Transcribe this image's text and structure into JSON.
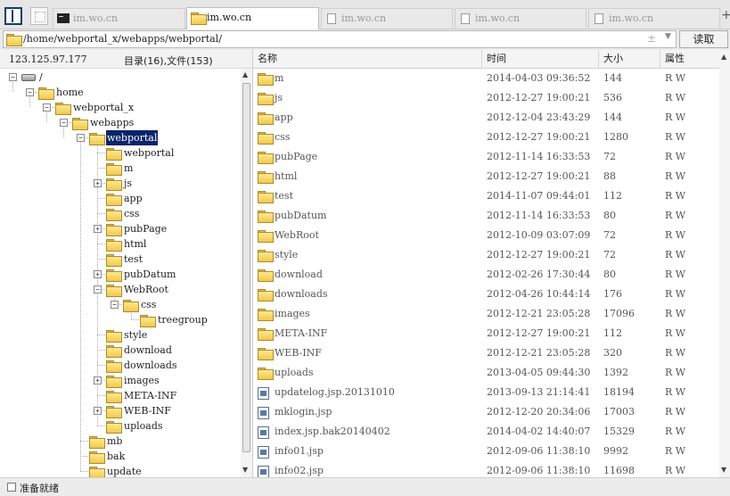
{
  "tabs": [
    {
      "label": "im.wo.cn",
      "icon": "terminal-icon",
      "active": false
    },
    {
      "label": "im.wo.cn",
      "icon": "folder-icon",
      "active": true
    },
    {
      "label": "im.wo.cn",
      "icon": "document-icon",
      "active": false
    },
    {
      "label": "im.wo.cn",
      "icon": "document-icon",
      "active": false
    },
    {
      "label": "im.wo.cn",
      "icon": "document-icon",
      "active": false
    }
  ],
  "tab_add": "+",
  "address": {
    "path": "/home/webportal_x/webapps/webportal/",
    "history_glyph": "±",
    "dropdown_glyph": "▼"
  },
  "read_button": "读取",
  "info": {
    "ip": "123.125.97.177",
    "counts": "目录(16),文件(153)"
  },
  "tree": [
    {
      "label": "/",
      "kind": "drive",
      "depth": 0,
      "toggle": "−"
    },
    {
      "label": "home",
      "kind": "folder",
      "depth": 1,
      "toggle": "−"
    },
    {
      "label": "webportal_x",
      "kind": "folder",
      "depth": 2,
      "toggle": "−"
    },
    {
      "label": "webapps",
      "kind": "folder",
      "depth": 3,
      "toggle": "−"
    },
    {
      "label": "webportal",
      "kind": "folder",
      "depth": 4,
      "toggle": "−",
      "selected": true
    },
    {
      "label": "webportal",
      "kind": "folder",
      "depth": 5,
      "toggle": ""
    },
    {
      "label": "m",
      "kind": "folder",
      "depth": 5,
      "toggle": ""
    },
    {
      "label": "js",
      "kind": "folder",
      "depth": 5,
      "toggle": "+"
    },
    {
      "label": "app",
      "kind": "folder",
      "depth": 5,
      "toggle": ""
    },
    {
      "label": "css",
      "kind": "folder",
      "depth": 5,
      "toggle": ""
    },
    {
      "label": "pubPage",
      "kind": "folder",
      "depth": 5,
      "toggle": "+"
    },
    {
      "label": "html",
      "kind": "folder",
      "depth": 5,
      "toggle": ""
    },
    {
      "label": "test",
      "kind": "folder",
      "depth": 5,
      "toggle": ""
    },
    {
      "label": "pubDatum",
      "kind": "folder",
      "depth": 5,
      "toggle": "+"
    },
    {
      "label": "WebRoot",
      "kind": "folder",
      "depth": 5,
      "toggle": "−"
    },
    {
      "label": "css",
      "kind": "folder",
      "depth": 6,
      "toggle": "−"
    },
    {
      "label": "treegroup",
      "kind": "folder",
      "depth": 7,
      "toggle": ""
    },
    {
      "label": "style",
      "kind": "folder",
      "depth": 5,
      "toggle": ""
    },
    {
      "label": "download",
      "kind": "folder",
      "depth": 5,
      "toggle": ""
    },
    {
      "label": "downloads",
      "kind": "folder",
      "depth": 5,
      "toggle": ""
    },
    {
      "label": "images",
      "kind": "folder",
      "depth": 5,
      "toggle": "+"
    },
    {
      "label": "META-INF",
      "kind": "folder",
      "depth": 5,
      "toggle": ""
    },
    {
      "label": "WEB-INF",
      "kind": "folder",
      "depth": 5,
      "toggle": "+"
    },
    {
      "label": "uploads",
      "kind": "folder",
      "depth": 5,
      "toggle": ""
    },
    {
      "label": "mb",
      "kind": "folder",
      "depth": 4,
      "toggle": ""
    },
    {
      "label": "bak",
      "kind": "folder",
      "depth": 4,
      "toggle": ""
    },
    {
      "label": "update",
      "kind": "folder",
      "depth": 4,
      "toggle": ""
    }
  ],
  "list_headers": {
    "name": "名称",
    "time": "时间",
    "size": "大小",
    "attr": "属性"
  },
  "files": [
    {
      "name": "m",
      "type": "folder",
      "time": "2014-04-03 09:36:52",
      "size": "144",
      "attr": "R W"
    },
    {
      "name": "js",
      "type": "folder",
      "time": "2012-12-27 19:00:21",
      "size": "536",
      "attr": "R W"
    },
    {
      "name": "app",
      "type": "folder",
      "time": "2012-12-04 23:43:29",
      "size": "144",
      "attr": "R W"
    },
    {
      "name": "css",
      "type": "folder",
      "time": "2012-12-27 19:00:21",
      "size": "1280",
      "attr": "R W"
    },
    {
      "name": "pubPage",
      "type": "folder",
      "time": "2012-11-14 16:33:53",
      "size": "72",
      "attr": "R W"
    },
    {
      "name": "html",
      "type": "folder",
      "time": "2012-12-27 19:00:21",
      "size": "88",
      "attr": "R W"
    },
    {
      "name": "test",
      "type": "folder",
      "time": "2014-11-07 09:44:01",
      "size": "112",
      "attr": "R W"
    },
    {
      "name": "pubDatum",
      "type": "folder",
      "time": "2012-11-14 16:33:53",
      "size": "80",
      "attr": "R W"
    },
    {
      "name": "WebRoot",
      "type": "folder",
      "time": "2012-10-09 03:07:09",
      "size": "72",
      "attr": "R W"
    },
    {
      "name": "style",
      "type": "folder",
      "time": "2012-12-27 19:00:21",
      "size": "72",
      "attr": "R W"
    },
    {
      "name": "download",
      "type": "folder",
      "time": "2012-02-26 17:30:44",
      "size": "80",
      "attr": "R W"
    },
    {
      "name": "downloads",
      "type": "folder",
      "time": "2012-04-26 10:44:14",
      "size": "176",
      "attr": "R W"
    },
    {
      "name": "images",
      "type": "folder",
      "time": "2012-12-21 23:05:28",
      "size": "17096",
      "attr": "R W"
    },
    {
      "name": "META-INF",
      "type": "folder",
      "time": "2012-12-27 19:00:21",
      "size": "112",
      "attr": "R W"
    },
    {
      "name": "WEB-INF",
      "type": "folder",
      "time": "2012-12-21 23:05:28",
      "size": "320",
      "attr": "R W"
    },
    {
      "name": "uploads",
      "type": "folder",
      "time": "2013-04-05 09:44:30",
      "size": "1392",
      "attr": "R W"
    },
    {
      "name": "updatelog.jsp.20131010",
      "type": "file",
      "time": "2013-09-13 21:14:41",
      "size": "18194",
      "attr": "R W"
    },
    {
      "name": "mklogin.jsp",
      "type": "file",
      "time": "2012-12-20 20:34:06",
      "size": "17003",
      "attr": "R W"
    },
    {
      "name": "index.jsp.bak20140402",
      "type": "file",
      "time": "2014-04-02 14:40:07",
      "size": "15329",
      "attr": "R W"
    },
    {
      "name": "info01.jsp",
      "type": "file",
      "time": "2012-09-06 11:38:10",
      "size": "9992",
      "attr": "R W"
    },
    {
      "name": "info02.jsp",
      "type": "file",
      "time": "2012-09-06 11:38:10",
      "size": "11698",
      "attr": "R W"
    }
  ],
  "status": "准备就绪",
  "colors": {
    "selection": "#0a246a",
    "folder": "#f1c84d"
  }
}
